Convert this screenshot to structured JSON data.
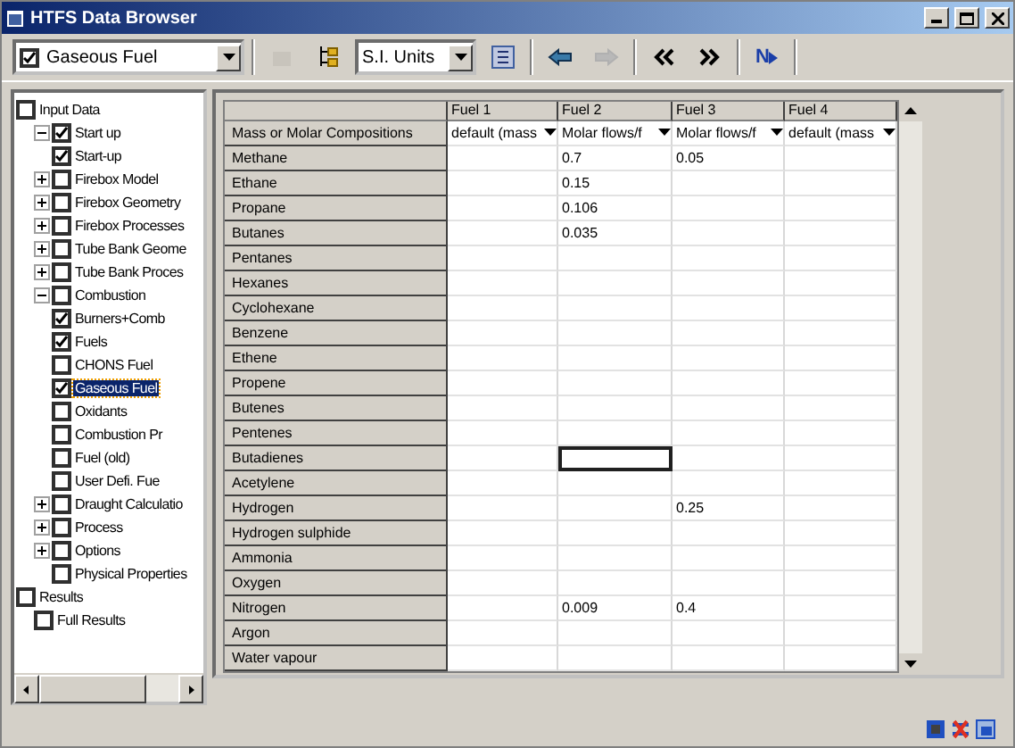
{
  "window": {
    "title": "HTFS Data Browser"
  },
  "toolbar": {
    "page_select": {
      "checked": true,
      "value": "Gaseous Fuel"
    },
    "units_select": {
      "value": "S.I. Units"
    },
    "back_enabled": true,
    "forward_enabled": false,
    "next_label": "N"
  },
  "tree": [
    {
      "label": "Input Data",
      "checked": false,
      "selected": false,
      "children": [
        {
          "label": "Start up",
          "checked": true,
          "selected": false,
          "expanded": true,
          "children": [
            {
              "label": "Start-up",
              "checked": true,
              "selected": false
            }
          ]
        },
        {
          "label": "Firebox Model",
          "checked": false,
          "selected": false,
          "expanded": false
        },
        {
          "label": "Firebox Geometry",
          "checked": false,
          "selected": false,
          "expanded": false
        },
        {
          "label": "Firebox Processes",
          "checked": false,
          "selected": false,
          "expanded": false
        },
        {
          "label": "Tube Bank Geome",
          "checked": false,
          "selected": false,
          "expanded": false
        },
        {
          "label": "Tube Bank Proces",
          "checked": false,
          "selected": false,
          "expanded": false
        },
        {
          "label": "Combustion",
          "checked": false,
          "selected": false,
          "expanded": true,
          "children": [
            {
              "label": "Burners+Comb",
              "checked": true,
              "selected": false
            },
            {
              "label": "Fuels",
              "checked": true,
              "selected": false
            },
            {
              "label": "CHONS Fuel",
              "checked": false,
              "selected": false
            },
            {
              "label": "Gaseous Fuel",
              "checked": true,
              "selected": true
            },
            {
              "label": "Oxidants",
              "checked": false,
              "selected": false
            },
            {
              "label": "Combustion Pr",
              "checked": false,
              "selected": false
            },
            {
              "label": "Fuel (old)",
              "checked": false,
              "selected": false
            },
            {
              "label": "User Defi. Fue",
              "checked": false,
              "selected": false
            }
          ]
        },
        {
          "label": "Draught Calculatio",
          "checked": false,
          "selected": false,
          "expanded": false
        },
        {
          "label": "Process",
          "checked": false,
          "selected": false,
          "expanded": false
        },
        {
          "label": "Options",
          "checked": false,
          "selected": false,
          "expanded": false
        },
        {
          "label": "Physical Properties",
          "checked": false,
          "selected": false
        }
      ]
    },
    {
      "label": "Results",
      "checked": false,
      "selected": false,
      "children": [
        {
          "label": "Full Results",
          "checked": false,
          "selected": false
        }
      ]
    }
  ],
  "grid": {
    "columns": [
      "Fuel 1",
      "Fuel 2",
      "Fuel 3",
      "Fuel 4"
    ],
    "basis_row": {
      "label": "Mass or Molar Compositions",
      "options": [
        "default (mass",
        "Molar flows/f",
        "Molar flows/f",
        "default (mass"
      ]
    },
    "rows": [
      {
        "name": "Methane",
        "cells": [
          {
            "selected": false
          },
          {
            "value": "0.7",
            "selected": false
          },
          {
            "value": "0.05",
            "selected": false
          },
          {
            "selected": false
          }
        ]
      },
      {
        "name": "Ethane",
        "cells": [
          {
            "selected": false
          },
          {
            "value": "0.15",
            "selected": false
          },
          {
            "selected": false
          },
          {
            "selected": false
          }
        ]
      },
      {
        "name": "Propane",
        "cells": [
          {
            "selected": false
          },
          {
            "value": "0.106",
            "selected": false
          },
          {
            "selected": false
          },
          {
            "selected": false
          }
        ]
      },
      {
        "name": "Butanes",
        "cells": [
          {
            "selected": false
          },
          {
            "value": "0.035",
            "selected": false
          },
          {
            "selected": false
          },
          {
            "selected": false
          }
        ]
      },
      {
        "name": "Pentanes",
        "cells": [
          {
            "selected": false
          },
          {
            "selected": false
          },
          {
            "selected": false
          },
          {
            "selected": false
          }
        ]
      },
      {
        "name": "Hexanes",
        "cells": [
          {
            "selected": false
          },
          {
            "selected": false
          },
          {
            "selected": false
          },
          {
            "selected": false
          }
        ]
      },
      {
        "name": "Cyclohexane",
        "cells": [
          {
            "selected": false
          },
          {
            "selected": false
          },
          {
            "selected": false
          },
          {
            "selected": false
          }
        ]
      },
      {
        "name": "Benzene",
        "cells": [
          {
            "selected": false
          },
          {
            "selected": false
          },
          {
            "selected": false
          },
          {
            "selected": false
          }
        ]
      },
      {
        "name": "Ethene",
        "cells": [
          {
            "selected": false
          },
          {
            "selected": false
          },
          {
            "selected": false
          },
          {
            "selected": false
          }
        ]
      },
      {
        "name": "Propene",
        "cells": [
          {
            "selected": false
          },
          {
            "selected": false
          },
          {
            "selected": false
          },
          {
            "selected": false
          }
        ]
      },
      {
        "name": "Butenes",
        "cells": [
          {
            "selected": false
          },
          {
            "selected": false
          },
          {
            "selected": false
          },
          {
            "selected": false
          }
        ]
      },
      {
        "name": "Pentenes",
        "cells": [
          {
            "selected": false
          },
          {
            "selected": false
          },
          {
            "selected": false
          },
          {
            "selected": false
          }
        ]
      },
      {
        "name": "Butadienes",
        "cells": [
          {
            "selected": false
          },
          {
            "selected": true
          },
          {
            "selected": false
          },
          {
            "selected": false
          }
        ]
      },
      {
        "name": "Acetylene",
        "cells": [
          {
            "selected": false
          },
          {
            "selected": false
          },
          {
            "selected": false
          },
          {
            "selected": false
          }
        ]
      },
      {
        "name": "Hydrogen",
        "cells": [
          {
            "selected": false
          },
          {
            "selected": false
          },
          {
            "value": "0.25",
            "selected": false
          },
          {
            "selected": false
          }
        ]
      },
      {
        "name": "Hydrogen sulphide",
        "cells": [
          {
            "selected": false
          },
          {
            "selected": false
          },
          {
            "selected": false
          },
          {
            "selected": false
          }
        ]
      },
      {
        "name": "Ammonia",
        "cells": [
          {
            "selected": false
          },
          {
            "selected": false
          },
          {
            "selected": false
          },
          {
            "selected": false
          }
        ]
      },
      {
        "name": "Oxygen",
        "cells": [
          {
            "selected": false
          },
          {
            "selected": false
          },
          {
            "selected": false
          },
          {
            "selected": false
          }
        ]
      },
      {
        "name": "Nitrogen",
        "cells": [
          {
            "selected": false
          },
          {
            "value": "0.009",
            "selected": false
          },
          {
            "value": "0.4",
            "selected": false
          },
          {
            "selected": false
          }
        ]
      },
      {
        "name": "Argon",
        "cells": [
          {
            "selected": false
          },
          {
            "selected": false
          },
          {
            "selected": false
          },
          {
            "selected": false
          }
        ]
      },
      {
        "name": "Water vapour",
        "cells": [
          {
            "selected": false
          },
          {
            "selected": false
          },
          {
            "selected": false
          },
          {
            "selected": false
          }
        ]
      }
    ]
  }
}
